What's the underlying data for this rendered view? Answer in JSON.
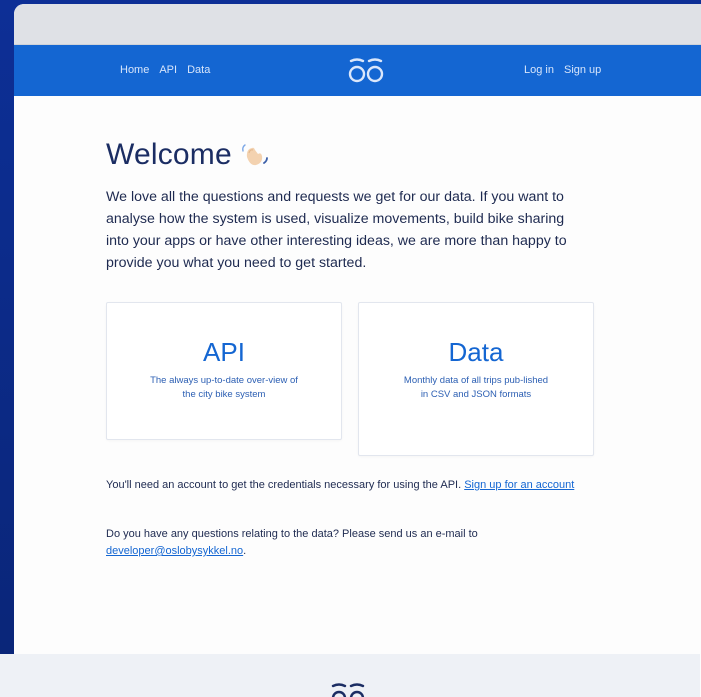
{
  "nav": {
    "left_links": [
      "Home",
      "API",
      "Data"
    ],
    "right_links": [
      "Log in",
      "Sign up"
    ]
  },
  "welcome": {
    "title": "Welcome",
    "intro": "We love all the questions and requests we get for our data. If you want to analyse how the system is used, visualize movements, build bike sharing into your apps or have other interesting ideas, we are more than happy to provide you what you need to get started."
  },
  "cards": {
    "api": {
      "title": "API",
      "description": "The always up-to-date over-view of the city bike system"
    },
    "data": {
      "title": "Data",
      "description": "Monthly data of all trips pub-lished in CSV and JSON formats"
    }
  },
  "notes": {
    "account_text": "You'll need an account to get the credentials necessary for using the API. ",
    "account_link": "Sign up for an account",
    "questions_text": "Do you have any questions relating to the data? Please send us an e-mail to ",
    "questions_link": "developer@oslobysykkel.no",
    "questions_end": "."
  },
  "colors": {
    "navbar": "#1466d2",
    "accent": "#1466d2",
    "heading": "#1b2d63"
  },
  "icons": {
    "logo": "bike-logo-icon",
    "wave": "waving-hand-icon"
  }
}
